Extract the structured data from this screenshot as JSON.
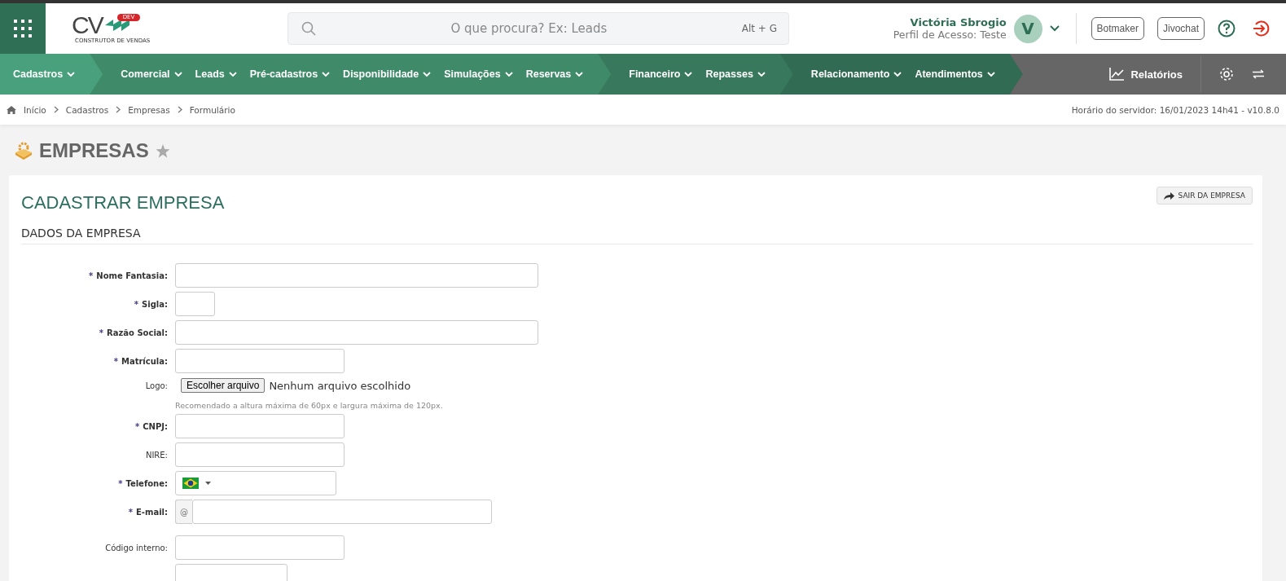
{
  "header": {
    "logo_text": "CV",
    "logo_badge": "DEV",
    "logo_caption": "CONSTRUTOR DE VENDAS",
    "search": {
      "placeholder": "O que procura? Ex: Leads",
      "shortcut": "Alt + G"
    },
    "user": {
      "name": "Victória Sbrogio",
      "profile": "Perfil de Acesso: Teste",
      "initial": "V"
    },
    "buttons": [
      "Botmaker",
      "Jivochat"
    ]
  },
  "nav": {
    "groups": [
      {
        "color": "#48a07c",
        "items": [
          "Cadastros"
        ]
      },
      {
        "color": "#3f8a69",
        "items": [
          "Comercial",
          "Leads",
          "Pré-cadastros",
          "Disponibilidade",
          "Simulações",
          "Reservas"
        ]
      },
      {
        "color": "#38785c",
        "items": [
          "Financeiro",
          "Repasses"
        ]
      },
      {
        "color": "#316b53",
        "items": [
          "Relacionamento",
          "Atendimentos"
        ]
      }
    ],
    "reports": "Relatórios"
  },
  "breadcrumb": [
    "Início",
    "Cadastros",
    "Empresas",
    "Formulário"
  ],
  "server_time": "Horário do servidor: 16/01/2023 14h41 - v10.8.0",
  "page_title": "EMPRESAS",
  "favorite": false,
  "form": {
    "title": "CADASTRAR EMPRESA",
    "exit_button": "SAIR DA EMPRESA",
    "section": "DADOS DA EMPRESA",
    "fields": [
      {
        "kind": "wide",
        "marker": "*",
        "label": "Nome Fantasia:",
        "required": true
      },
      {
        "kind": "tiny",
        "marker": "*",
        "label": "Sigla:",
        "required": true
      },
      {
        "kind": "wide",
        "marker": "*",
        "label": "Razão Social:",
        "required": true
      },
      {
        "kind": "medium",
        "marker": "*",
        "label": "Matrícula:",
        "required": true
      },
      {
        "kind": "file",
        "label": "Logo:",
        "required": false,
        "button": "Escolher arquivo",
        "status": "Nenhum arquivo escolhido",
        "hint": "Recomendado a altura máxima de 60px e largura máxima de 120px."
      },
      {
        "kind": "medium",
        "marker": "*",
        "label": "CNPJ:",
        "required": true
      },
      {
        "kind": "medium",
        "label": "NIRE:",
        "required": false
      },
      {
        "kind": "phone",
        "marker": "*",
        "label": "Telefone:",
        "required": true
      },
      {
        "kind": "email",
        "marker": "*",
        "label": "E-mail:",
        "required": true,
        "addon": "@"
      },
      {
        "kind": "medium",
        "label": "Código interno:",
        "required": false
      },
      {
        "kind": "short"
      }
    ]
  }
}
